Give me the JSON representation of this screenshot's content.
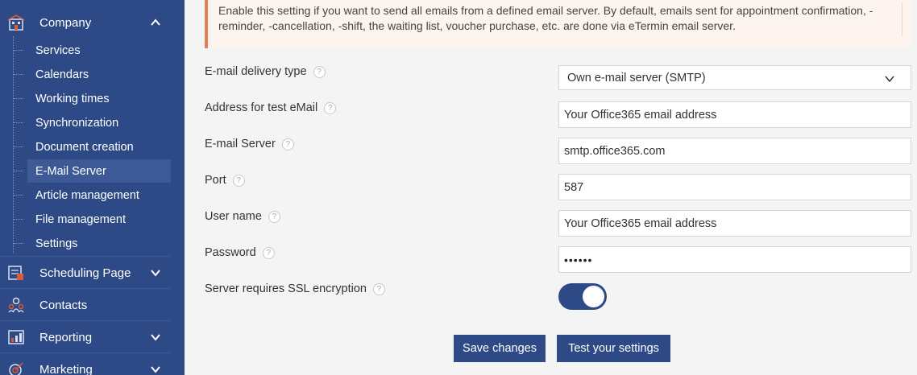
{
  "sidebar": {
    "company": {
      "label": "Company"
    },
    "sub_items": [
      {
        "label": "Services"
      },
      {
        "label": "Calendars"
      },
      {
        "label": "Working times"
      },
      {
        "label": "Synchronization"
      },
      {
        "label": "Document creation"
      },
      {
        "label": "E-Mail Server",
        "active": true
      },
      {
        "label": "Article management"
      },
      {
        "label": "File management"
      },
      {
        "label": "Settings"
      }
    ],
    "scheduling": {
      "label": "Scheduling Page"
    },
    "contacts": {
      "label": "Contacts"
    },
    "reporting": {
      "label": "Reporting"
    },
    "marketing": {
      "label": "Marketing"
    }
  },
  "notice": {
    "text": "Enable this setting if you want to send all emails from a defined email server. By default, emails sent for appointment confirmation, -reminder, -cancellation, -shift, the waiting list, voucher purchase, etc. are done via eTermin email server."
  },
  "form": {
    "delivery_type": {
      "label": "E-mail delivery type",
      "value": "Own e-mail server (SMTP)"
    },
    "test_address": {
      "label": "Address for test eMail",
      "value": "Your Office365 email address"
    },
    "server": {
      "label": "E-mail Server",
      "value": "smtp.office365.com"
    },
    "port": {
      "label": "Port",
      "value": "587"
    },
    "username": {
      "label": "User name",
      "value": "Your Office365 email address"
    },
    "password": {
      "label": "Password",
      "value": "••••••"
    },
    "ssl": {
      "label": "Server requires SSL encryption",
      "enabled": true
    }
  },
  "buttons": {
    "save": "Save changes",
    "test": "Test your settings"
  },
  "colors": {
    "sidebar_bg": "#2d4a86",
    "accent": "#2d4a86",
    "notice_border": "#e0805a"
  }
}
